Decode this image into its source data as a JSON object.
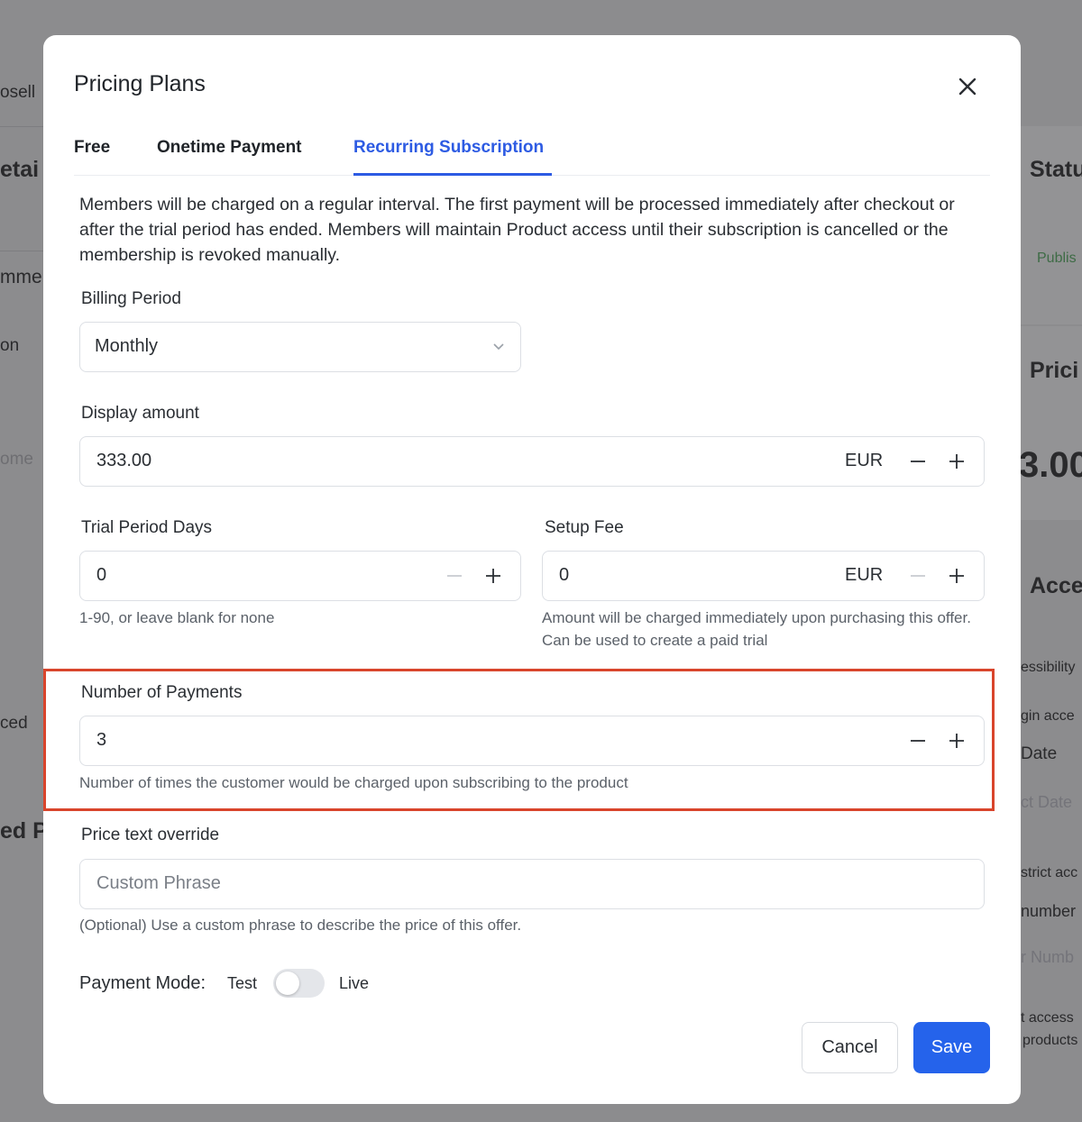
{
  "background": {
    "fragments": [
      "osell",
      "etai",
      "mme",
      "on",
      "ome",
      "ced",
      "ed P",
      "Statu",
      "Publis",
      "Prici",
      "3.00",
      "Acce",
      "essibility",
      "gin acce",
      "Date",
      "ct Date",
      "strict acc",
      "number",
      "r Numb",
      "t access",
      "products"
    ]
  },
  "modal": {
    "title": "Pricing Plans",
    "tabs": [
      {
        "label": "Free"
      },
      {
        "label": "Onetime Payment"
      },
      {
        "label": "Recurring Subscription"
      }
    ],
    "active_tab": "Recurring Subscription",
    "description": "Members will be charged on a regular interval. The first payment will be processed immediately after checkout or after the trial period has ended. Members will maintain Product access until their subscription is cancelled or the membership is revoked manually.",
    "billing_period": {
      "label": "Billing Period",
      "value": "Monthly"
    },
    "display_amount": {
      "label": "Display amount",
      "value": "333.00",
      "currency": "EUR"
    },
    "trial_period": {
      "label": "Trial Period Days",
      "value": "0",
      "helper": "1-90, or leave blank for none"
    },
    "setup_fee": {
      "label": "Setup Fee",
      "value": "0",
      "currency": "EUR",
      "helper": "Amount will be charged immediately upon purchasing this offer. Can be used to create a paid trial"
    },
    "number_of_payments": {
      "label": "Number of Payments",
      "value": "3",
      "helper": "Number of times the customer would be charged upon subscribing to the product"
    },
    "price_text_override": {
      "label": "Price text override",
      "placeholder": "Custom Phrase",
      "helper": "(Optional) Use a custom phrase to describe the price of this offer."
    },
    "payment_mode": {
      "label": "Payment Mode:",
      "left": "Test",
      "right": "Live",
      "is_live": false
    },
    "cancel_label": "Cancel",
    "save_label": "Save"
  },
  "colors": {
    "accent": "#2d5be3",
    "save": "#2563eb",
    "highlight": "#d9452c"
  }
}
